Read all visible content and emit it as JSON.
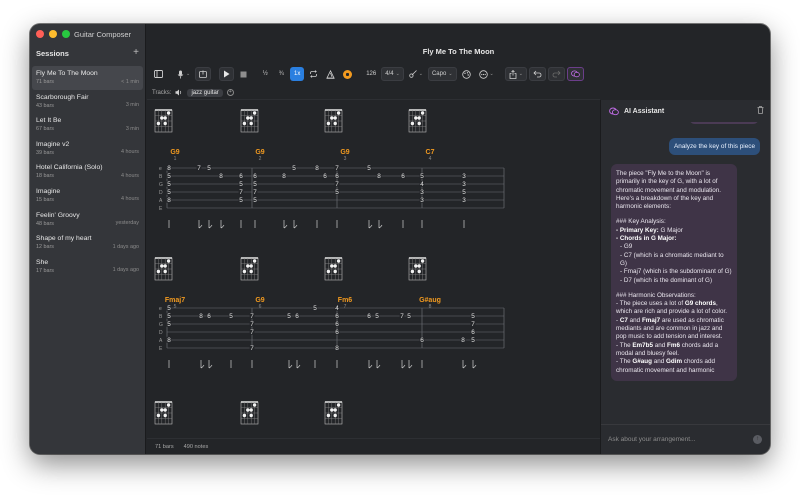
{
  "app": {
    "title": "Guitar Composer"
  },
  "sidebar": {
    "title": "Sessions",
    "add_icon": "+",
    "sessions": [
      {
        "title": "Fly Me To The Moon",
        "bars": "71 bars",
        "time": "< 1 min",
        "active": true
      },
      {
        "title": "Scarborough Fair",
        "bars": "43 bars",
        "time": "3 min"
      },
      {
        "title": "Let It Be",
        "bars": "67 bars",
        "time": "3 min"
      },
      {
        "title": "Imagine v2",
        "bars": "39 bars",
        "time": "4 hours"
      },
      {
        "title": "Hotel California (Solo)",
        "bars": "18 bars",
        "time": "4 hours"
      },
      {
        "title": "Imagine",
        "bars": "15 bars",
        "time": "4 hours"
      },
      {
        "title": "Feelin' Groovy",
        "bars": "48 bars",
        "time": "yesterday"
      },
      {
        "title": "Shape of my heart",
        "bars": "12 bars",
        "time": "1 days ago"
      },
      {
        "title": "She",
        "bars": "17 bars",
        "time": "1 days ago"
      }
    ]
  },
  "document": {
    "title": "Fly Me To The Moon"
  },
  "toolbar": {
    "speed_half": "½",
    "speed_three_quarter": "¾",
    "speed_full": "1x",
    "tempo": "126",
    "time_signature": "4/4",
    "capo_label": "Capo"
  },
  "tracks": {
    "label": "Tracks:",
    "items": [
      "jazz guitar"
    ]
  },
  "score": {
    "string_names": [
      "e",
      "B",
      "G",
      "D",
      "A",
      "E"
    ],
    "systems": [
      {
        "chords": [
          {
            "name": "G9",
            "bar": "1",
            "color": "#f29a1f"
          },
          {
            "name": "G9",
            "bar": "2",
            "color": "#f29a1f"
          },
          {
            "name": "G9",
            "bar": "3",
            "color": "#f29a1f"
          },
          {
            "name": "C7",
            "bar": "4",
            "color": "#f29a1f"
          }
        ]
      },
      {
        "chords": [
          {
            "name": "Fmaj7",
            "bar": "5",
            "color": "#f29a1f"
          },
          {
            "name": "G9",
            "bar": "6",
            "color": "#f29a1f"
          },
          {
            "name": "Fm6",
            "bar": "7",
            "color": "#f29a1f"
          },
          {
            "name": "G#aug",
            "bar": "8",
            "color": "#f29a1f"
          }
        ]
      }
    ]
  },
  "status": {
    "bars": "71 bars",
    "notes": "490 notes"
  },
  "assistant": {
    "title": "AI Assistant",
    "user_message": "Analyze the key of this piece",
    "input_placeholder": "Ask about your arrangement...",
    "reply": {
      "p1": "The piece \"Fly Me to the Moon\" is primarily in the key of G, with a lot of chromatic movement and modulation. Here's a breakdown of the key and harmonic elements:",
      "h1": "### Key Analysis:",
      "l1_label": "- Primary Key:",
      "l1_value": " G Major",
      "l2_label": "- Chords in G Major:",
      "l3": "- G9",
      "l4": "- C7 (which is a chromatic mediant to G)",
      "l5": "- Fmaj7 (which is the subdominant of G)",
      "l6": "- D7 (which is the dominant of G)",
      "h2": "### Harmonic Observations:",
      "o1_a": "- The piece uses a lot of ",
      "o1_b": "G9 chords",
      "o1_c": ", which are rich and provide a lot of color.",
      "o2_a": "- ",
      "o2_b": "C7",
      "o2_c": " and ",
      "o2_d": "Fmaj7",
      "o2_e": " are used as chromatic mediants and are common in jazz and pop music to add tension and interest.",
      "o3_a": "- The ",
      "o3_b": "Em7b5",
      "o3_c": " and ",
      "o3_d": "Fm6",
      "o3_e": " chords add a modal and bluesy feel.",
      "o4_a": "- The ",
      "o4_b": "G#aug",
      "o4_c": " and ",
      "o4_d": "Gdim",
      "o4_e": " chords add chromatic movement and harmonic"
    }
  }
}
